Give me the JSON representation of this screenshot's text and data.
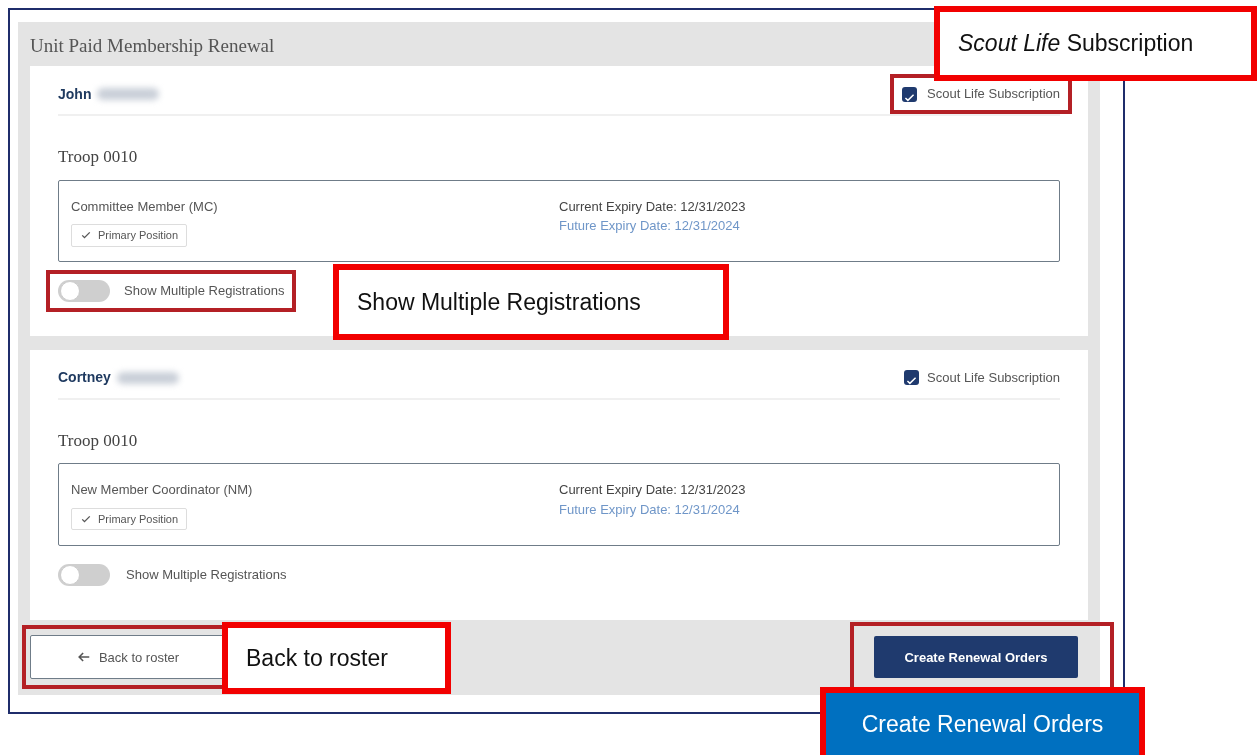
{
  "panel": {
    "title": "Unit Paid Membership Renewal"
  },
  "members": [
    {
      "first_name": "John",
      "surname_blurred": true,
      "subscription": {
        "label": "Scout Life Subscription",
        "checked": true,
        "highlighted": true
      },
      "unit": "Troop 0010",
      "position": "Committee Member (MC)",
      "badge": "Primary Position",
      "current_expiry": "Current Expiry Date: 12/31/2023",
      "future_expiry": "Future Expiry Date: 12/31/2024",
      "toggle": {
        "label": "Show Multiple Registrations",
        "on": false,
        "highlighted": true
      }
    },
    {
      "first_name": "Cortney",
      "surname_blurred": true,
      "subscription": {
        "label": "Scout Life Subscription",
        "checked": true,
        "highlighted": false
      },
      "unit": "Troop 0010",
      "position": "New Member Coordinator (NM)",
      "badge": "Primary Position",
      "current_expiry": "Current Expiry Date: 12/31/2023",
      "future_expiry": "Future Expiry Date: 12/31/2024",
      "toggle": {
        "label": "Show Multiple Registrations",
        "on": false,
        "highlighted": false
      }
    }
  ],
  "footer": {
    "back_button": {
      "label": "Back to roster",
      "highlighted": true
    },
    "create_button": {
      "label": "Create Renewal Orders",
      "highlighted": true
    }
  },
  "callouts": [
    {
      "text": "*Scout Life* Subscription",
      "kind": "plain"
    },
    {
      "text": "Show Multiple Registrations",
      "kind": "plain"
    },
    {
      "text": "Back to roster",
      "kind": "plain"
    },
    {
      "text": "Create Renewal Orders",
      "kind": "filled"
    }
  ]
}
